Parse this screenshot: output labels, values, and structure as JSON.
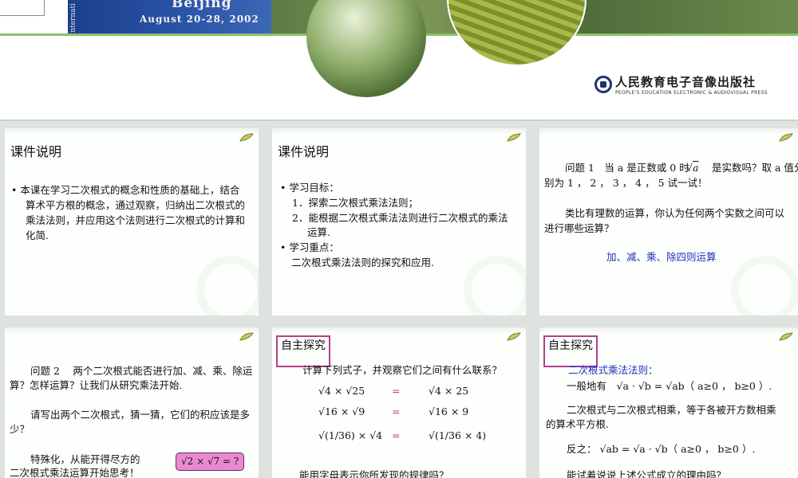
{
  "banner": {
    "poster_city": "Beijing",
    "poster_dates": "August 20-28, 2002",
    "poster_vertical": "Internati",
    "publisher_cn": "人民教育电子音像出版社",
    "publisher_en": "PEOPLE'S EDUCATION ELECTRONIC & AUDIOVISUAL PRESS"
  },
  "slide1": {
    "title": "课件说明",
    "bullet": "• 本课在学习二次根式的概念和性质的基础上，结合",
    "lines": [
      "算术平方根的概念，通过观察，归纳出二次根式的",
      "乘法法则，并应用这个法则进行二次根式的计算和",
      "化简."
    ]
  },
  "slide2": {
    "title": "课件说明",
    "b1": "•  学习目标：",
    "g1": "1．探索二次根式乘法法则；",
    "g2": "2．能根据二次根式乘法法则进行二次根式的乘法",
    "g2b": "运算.",
    "b2": "•  学习重点：",
    "focus": "二次根式乘法法则的探究和应用."
  },
  "slide3": {
    "q1a": "问题 1　当 a 是正数或 0 时",
    "q1b": "是实数吗？取 a 值分",
    "q1c": "别为 1 ， 2 ， 3 ， 4 ， 5 试一试！",
    "q2a": "类比有理数的运算，你认为任何两个实数之间可以",
    "q2b": "进行哪些运算？",
    "answer": "加、减、乘、除四则运算"
  },
  "slide4": {
    "q2a": "问题 2　 两个二次根式能否进行加、减、乘、除运",
    "q2b": "算？怎样运算？让我们从研究乘法开始.",
    "p2a": "请写出两个二次根式，猜一猜，它们的积应该是多",
    "p2b": "少？",
    "p3a": "特殊化，从能开得尽方的",
    "p3b": "二次根式乘法运算开始思考！",
    "tag": "√2 × √7 = ?"
  },
  "slide5": {
    "title": "自主探究",
    "prompt": "计算下列式子，并观察它们之间有什么联系？",
    "rows": [
      {
        "left": "√4 × √25",
        "eq": "=",
        "right": "√4 × 25"
      },
      {
        "left": "√16 × √9",
        "eq": "=",
        "right": "√16 × 9"
      },
      {
        "left": "√(1/36) × √4",
        "eq": "=",
        "right": "√(1/36 × 4)"
      }
    ],
    "bottom": "能用字母表示你所发现的规律吗？"
  },
  "slide6": {
    "title": "自主探究",
    "rule": "二次根式乘法法则：",
    "general": "一般地有　√a · √b = √ab（ a≥0 ，  b≥0 ）.",
    "explain_a": "二次根式与二次根式相乘，等于各被开方数相乘",
    "explain_b": "的算术平方根.",
    "reverse": "反之：  √ab = √a · √b（ a≥0 ，  b≥0 ）.",
    "bottom": "能试着说说上述公式成立的理由吗？"
  }
}
